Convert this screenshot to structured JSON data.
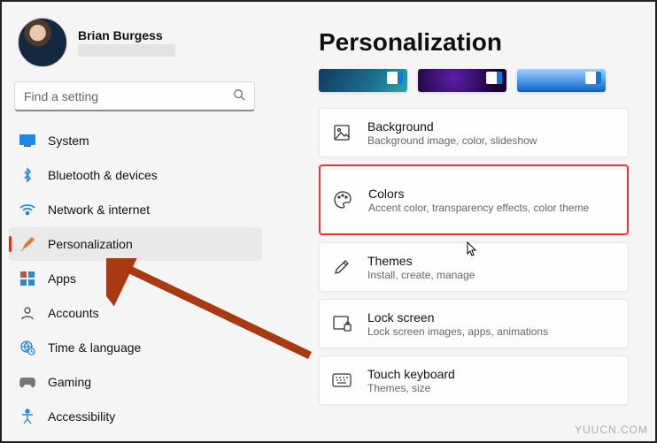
{
  "profile": {
    "name": "Brian Burgess"
  },
  "search": {
    "placeholder": "Find a setting"
  },
  "sidebar": {
    "items": [
      {
        "label": "System"
      },
      {
        "label": "Bluetooth & devices"
      },
      {
        "label": "Network & internet"
      },
      {
        "label": "Personalization"
      },
      {
        "label": "Apps"
      },
      {
        "label": "Accounts"
      },
      {
        "label": "Time & language"
      },
      {
        "label": "Gaming"
      },
      {
        "label": "Accessibility"
      }
    ]
  },
  "page": {
    "title": "Personalization"
  },
  "cards": {
    "background": {
      "title": "Background",
      "desc": "Background image, color, slideshow"
    },
    "colors": {
      "title": "Colors",
      "desc": "Accent color, transparency effects, color theme"
    },
    "themes": {
      "title": "Themes",
      "desc": "Install, create, manage"
    },
    "lockscreen": {
      "title": "Lock screen",
      "desc": "Lock screen images, apps, animations"
    },
    "touchkb": {
      "title": "Touch keyboard",
      "desc": "Themes, size"
    }
  },
  "watermark": "YUUCN.COM"
}
